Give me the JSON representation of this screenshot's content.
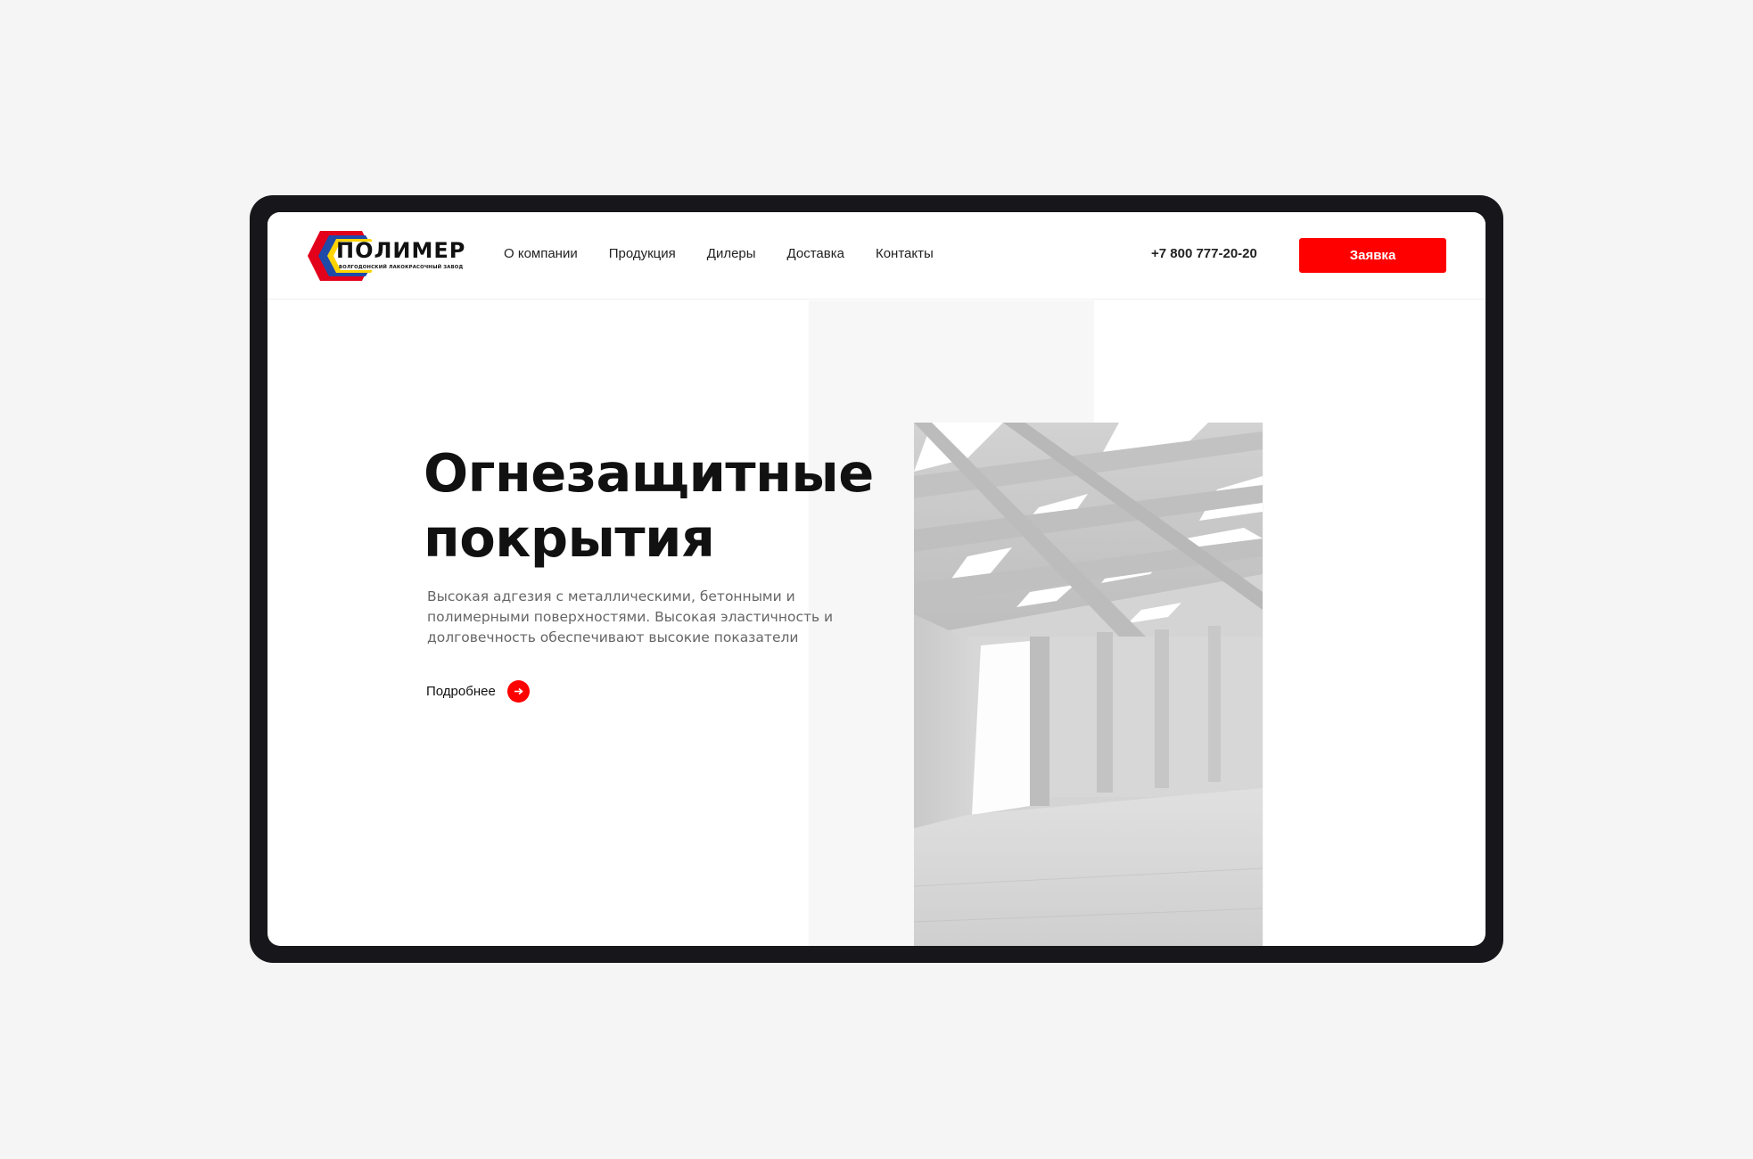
{
  "brand": {
    "name": "ПОЛИМЕР",
    "tagline": "ВОЛГОДОНСКИЙ ЛАКОКРАСОЧНЫЙ ЗАВОД",
    "colors": {
      "red": "#e2001a",
      "blue": "#1f4aa8",
      "yellow": "#ffd400"
    }
  },
  "nav": {
    "items": [
      {
        "label": "О компании"
      },
      {
        "label": "Продукция"
      },
      {
        "label": "Дилеры"
      },
      {
        "label": "Доставка"
      },
      {
        "label": "Контакты"
      }
    ]
  },
  "header": {
    "phone": "+7 800 777-20-20",
    "cta_label": "Заявка"
  },
  "hero": {
    "title_lines": [
      "Огнезащитные",
      "покрытия"
    ],
    "description_lines": [
      "Высокая адгезия с металлическими, бетонными и",
      "полимерными поверхностями. Высокая эластичность и",
      "долговечность обеспечивают высокие показатели"
    ],
    "more_label": "Подробнее",
    "more_icon": "arrow-right-icon",
    "image": "concrete-interior-photo"
  },
  "colors": {
    "accent": "#ff0000",
    "device_frame": "#17171b",
    "page_bg": "#f5f5f5",
    "text": "#111111",
    "muted": "#666666"
  }
}
